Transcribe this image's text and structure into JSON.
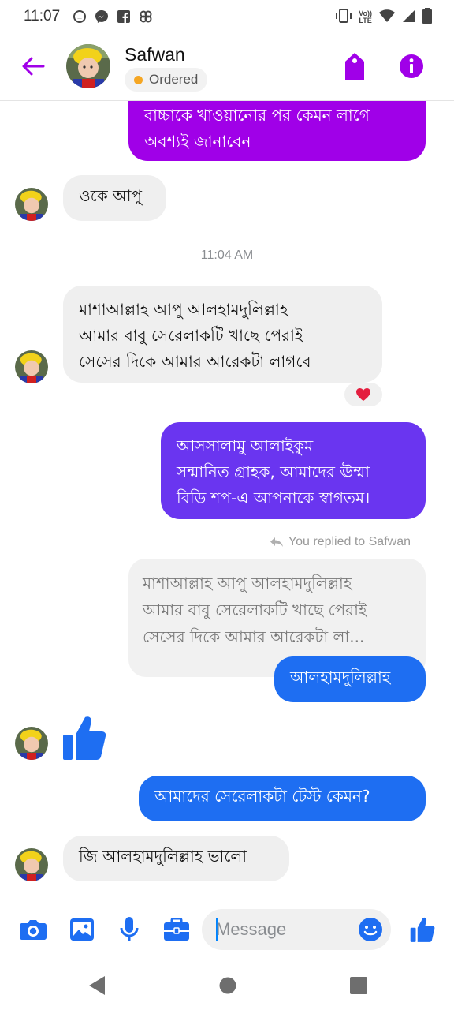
{
  "status_bar": {
    "time": "11:07",
    "left_icons": [
      "notification-icon",
      "messenger-icon",
      "facebook-icon",
      "app-icon"
    ],
    "right_icons": [
      "vibrate-icon",
      "volte-icon",
      "wifi-icon",
      "signal-icon",
      "battery-icon"
    ],
    "volte_label_top": "Vo))",
    "volte_label_bottom": "LTE"
  },
  "header": {
    "contact_name": "Safwan",
    "order_status": "Ordered",
    "accent_color": "#a000e8"
  },
  "messages": {
    "m1_out": "বাচ্চাকে খাওয়ানোর পর কেমন লাগে\nঅবশ্যই জানাবেন",
    "m2_in": "ওকে আপু",
    "timestamp": "11:04 AM",
    "m3_in": "মাশাআল্লাহ আপু আলহামদুলিল্লাহ\nআমার বাবু সেরেলাকটি খাছে পেরাই\nসেসের দিকে আমার আরেকটা লাগবে",
    "m3_reaction": "heart",
    "m4_out": "আসসালামু আলাইকুম\nসন্মানিত গ্রাহক, আমাদের ঊম্মা\nবিডি শপ-এ  আপনাকে স্বাগতম।",
    "replied_note": "You replied to Safwan",
    "quoted_text": "মাশাআল্লাহ আপু আলহামদুলিল্লাহ\nআমার বাবু সেরেলাকটি খাছে পেরাই\nসেসের দিকে আমার আরেকটা লা...",
    "m5_out": "আলহামদুলিল্লাহ",
    "m6_in": "like",
    "m7_out": "আমাদের সেরেলাকটা টেস্ট কেমন?",
    "m8_in": "জি আলহামদুলিল্লাহ ভালো"
  },
  "composer": {
    "placeholder": "Message",
    "icons": [
      "camera-icon",
      "gallery-icon",
      "microphone-icon",
      "briefcase-icon",
      "emoji-icon",
      "thumbs-up-icon"
    ]
  },
  "nav": {
    "buttons": [
      "back-triangle-icon",
      "home-circle-icon",
      "recents-square-icon"
    ]
  },
  "colors": {
    "purple": "#a000e8",
    "violet": "#6a35f0",
    "blue": "#1e6ef2",
    "incoming_bg": "#efefef"
  }
}
